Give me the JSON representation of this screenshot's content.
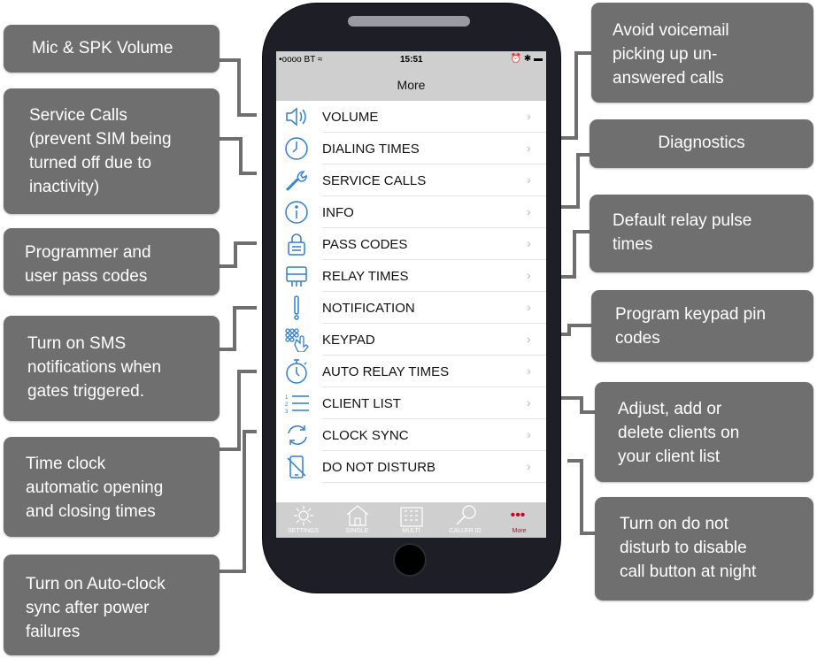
{
  "phone": {
    "status": {
      "carrier": "•oooo BT ≈",
      "time": "15:51",
      "right": "⏰ ✱ ▬"
    },
    "nav_title": "More",
    "menu": [
      {
        "label": "VOLUME",
        "icon": "speaker-volume-icon"
      },
      {
        "label": "DIALING TIMES",
        "icon": "clock-icon"
      },
      {
        "label": "SERVICE CALLS",
        "icon": "wrench-icon"
      },
      {
        "label": "INFO",
        "icon": "info-icon"
      },
      {
        "label": "PASS CODES",
        "icon": "padlock-icon"
      },
      {
        "label": "RELAY TIMES",
        "icon": "relay-icon"
      },
      {
        "label": "NOTIFICATION",
        "icon": "exclamation-icon"
      },
      {
        "label": "KEYPAD",
        "icon": "keypad-icon"
      },
      {
        "label": "AUTO RELAY TIMES",
        "icon": "stopwatch-icon"
      },
      {
        "label": "CLIENT LIST",
        "icon": "numbered-list-icon"
      },
      {
        "label": "CLOCK SYNC",
        "icon": "sync-icon"
      },
      {
        "label": "DO NOT DISTURB",
        "icon": "do-not-disturb-phone-icon"
      }
    ],
    "chevron": "›",
    "tabs": [
      {
        "label": "SETTINGS",
        "icon": "gear-icon"
      },
      {
        "label": "SINGLE",
        "icon": "house-icon"
      },
      {
        "label": "MULTI",
        "icon": "building-icon"
      },
      {
        "label": "CALLER ID",
        "icon": "magnifier-icon"
      },
      {
        "label": "More",
        "icon": "more-dots-icon",
        "glyph": "•••",
        "active": true
      }
    ],
    "colors": {
      "accent": "#2f7fd2",
      "active_tab": "#d0021b",
      "body": "#1d1e26",
      "bars": "#cfcfcf"
    }
  },
  "callouts": {
    "mic_spk": [
      "Mic & SPK Volume"
    ],
    "service_calls": [
      "Service Calls",
      "(prevent SIM being",
      "turned off due to",
      "inactivity)"
    ],
    "pass_codes": [
      "Programmer and",
      "user pass codes"
    ],
    "sms": [
      "Turn on SMS",
      "notifications when",
      "gates triggered."
    ],
    "time_clock": [
      "Time clock",
      "automatic opening",
      "and closing times"
    ],
    "auto_clock": [
      "Turn on Auto-clock",
      "sync after power",
      "failures"
    ],
    "voicemail": [
      "Avoid voicemail",
      "picking up un-",
      "answered calls"
    ],
    "diagnostics": [
      "Diagnostics"
    ],
    "relay_pulse": [
      "Default relay pulse",
      "times"
    ],
    "keypad_pin": [
      "Program keypad pin",
      "codes"
    ],
    "clients": [
      "Adjust, add or",
      "delete clients on",
      "your client list"
    ],
    "dnd": [
      "Turn on do not",
      "disturb to disable",
      "call button at night"
    ]
  }
}
